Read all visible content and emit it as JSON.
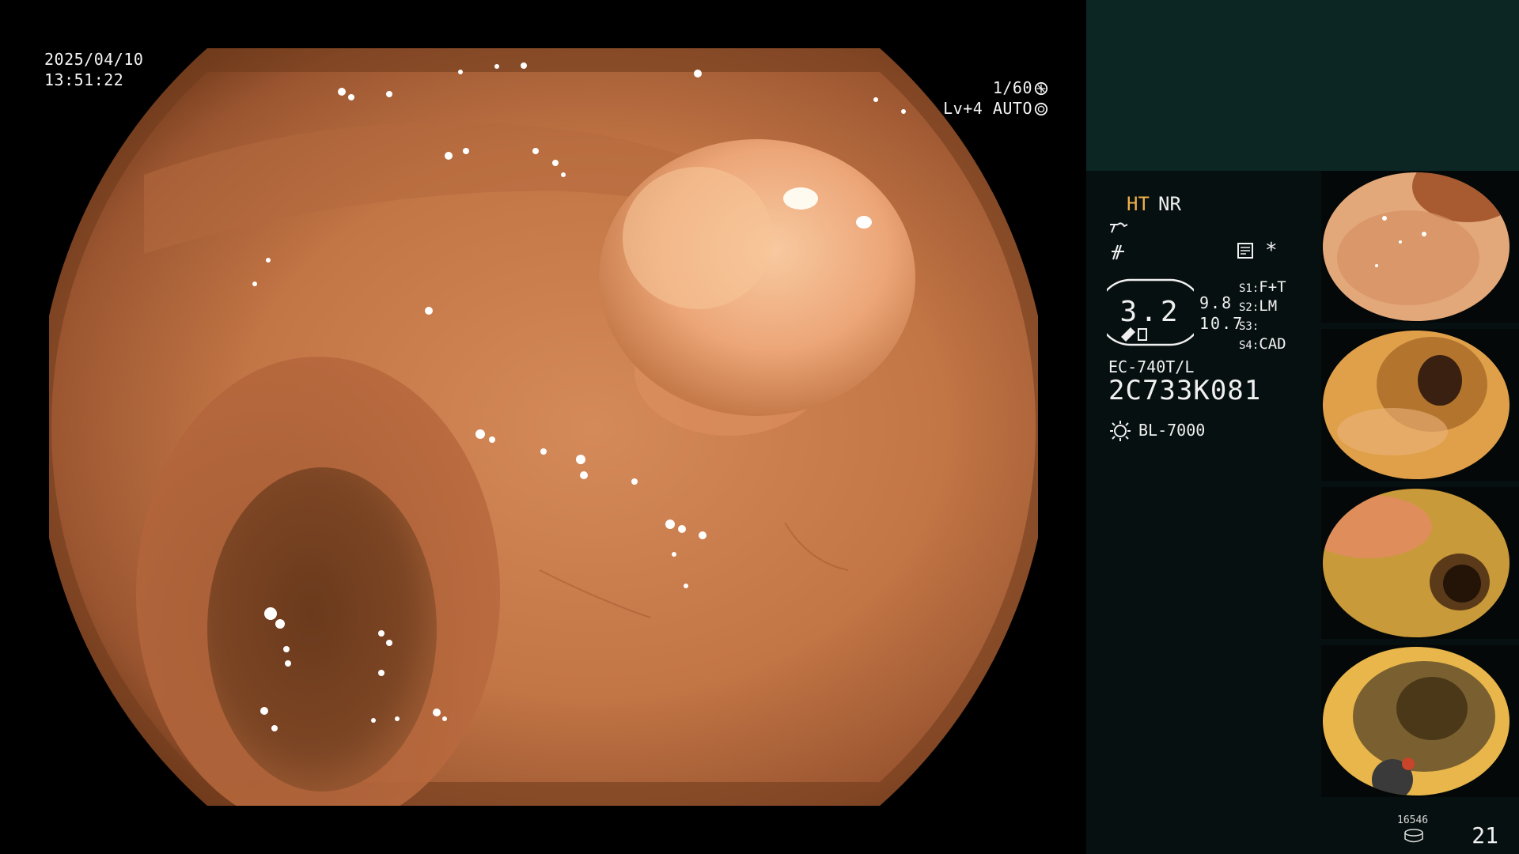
{
  "osd": {
    "date": "2025/04/10",
    "time": "13:51:22",
    "shutter": "1/60",
    "level": "Lv+4",
    "iris_mode": "AUTO"
  },
  "info": {
    "ht": "HT",
    "nr": "NR",
    "asterisk": "*",
    "zoom": "3.2",
    "zoom_aux_1": "9.8",
    "zoom_aux_2": "10.7",
    "switches": [
      {
        "key": "S1:",
        "value": "F+T"
      },
      {
        "key": "S2:",
        "value": "LM"
      },
      {
        "key": "S3:",
        "value": ""
      },
      {
        "key": "S4:",
        "value": "CAD"
      }
    ],
    "scope_model": "EC-740T/L",
    "scope_serial": "2C733K081",
    "light_source": "BL-7000"
  },
  "footer": {
    "storage_count": "16546",
    "page": "21"
  },
  "colors": {
    "accent_ht": "#f0b04a",
    "panel_top": "#0b2623",
    "panel_bg": "#071010",
    "mucosa": "#c8794a"
  },
  "icons": [
    "shutter-icon",
    "iris-icon",
    "structure-enhance-icon",
    "color-enhance-icon",
    "memo-icon",
    "scope-tip-icon",
    "light-source-icon",
    "storage-disk-icon"
  ]
}
